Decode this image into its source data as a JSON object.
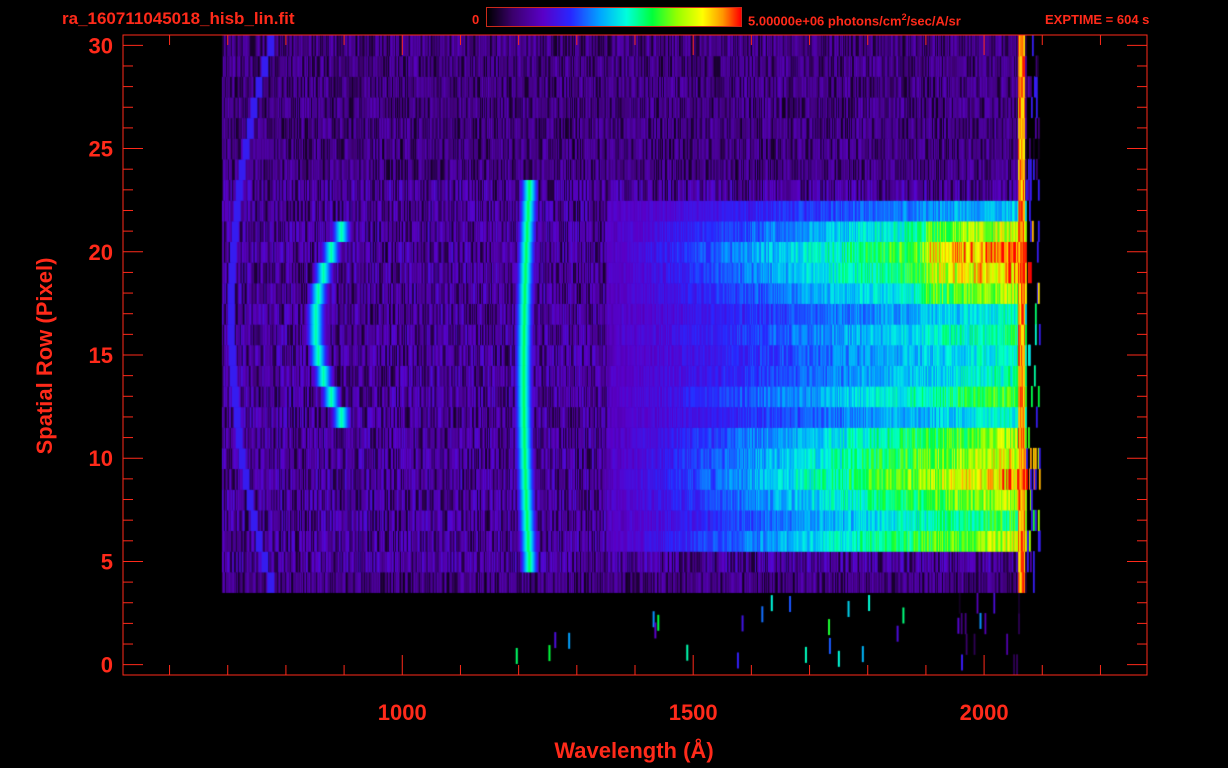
{
  "header": {
    "filename": "ra_160711045018_hisb_lin.fit",
    "colorbar_min": "0",
    "colorbar_max_prefix": "5.00000e+06 photons/cm",
    "colorbar_max_exp": "2",
    "colorbar_max_suffix": "/sec/A/sr",
    "exptime": "EXPTIME = 604 s"
  },
  "colors": {
    "axis": "#ff2a1a",
    "background": "#000000"
  },
  "chart_data": {
    "type": "heatmap",
    "title": "ra_160711045018_hisb_lin.fit",
    "xlabel": "Wavelength (Å)",
    "ylabel": "Spatial Row (Pixel)",
    "xlim": [
      520,
      2280
    ],
    "ylim": [
      -0.5,
      30.5
    ],
    "x_ticks": [
      1000,
      1500,
      2000
    ],
    "y_ticks": [
      0,
      5,
      10,
      15,
      20,
      25,
      30
    ],
    "colorscale": "rainbow",
    "zlim": [
      0,
      5000000
    ],
    "zunit": "photons/cm^2/sec/A/sr",
    "rows_illuminated": [
      4,
      30
    ],
    "features": [
      {
        "name": "arc",
        "wavelength_center": 850,
        "rows": [
          12,
          21
        ],
        "level": 0.5
      },
      {
        "name": "line",
        "wavelength": 1216,
        "rows": [
          5,
          23
        ],
        "level": 0.55
      },
      {
        "name": "continuum",
        "wavelength_start": 1550,
        "wavelength_end": 2060,
        "rows": [
          6,
          22
        ],
        "level": 0.7
      }
    ]
  }
}
